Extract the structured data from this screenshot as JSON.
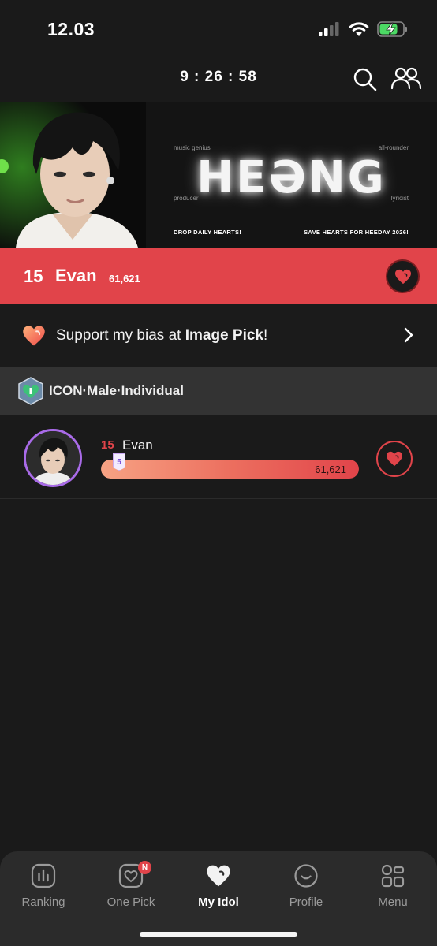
{
  "status": {
    "time": "12.03"
  },
  "header": {
    "timer": "9 : 26 : 58"
  },
  "banner": {
    "title": "HEƏNG",
    "tag_top_left": "music genius",
    "tag_top_right": "all-rounder",
    "tag_bottom_left": "producer",
    "tag_bottom_right": "lyricist",
    "footer_left": "DROP DAILY HEARTS!",
    "footer_right": "SAVE HEARTS FOR HEEDAY 2026!"
  },
  "rank_bar": {
    "rank": "15",
    "name": "Evan",
    "votes": "61,621"
  },
  "support": {
    "text_before": "Support my bias at ",
    "text_bold": "Image Pick",
    "text_after": "!"
  },
  "category": {
    "label": "ICON·Male·Individual"
  },
  "idol": {
    "rank": "15",
    "name": "Evan",
    "votes": "61,621",
    "level": "5",
    "progress_fraction": 1.0
  },
  "nav": {
    "items": [
      {
        "label": "Ranking",
        "icon": "ranking-icon"
      },
      {
        "label": "One Pick",
        "icon": "one-pick-icon",
        "badge": "N"
      },
      {
        "label": "My Idol",
        "icon": "my-idol-icon",
        "active": true
      },
      {
        "label": "Profile",
        "icon": "profile-icon"
      },
      {
        "label": "Menu",
        "icon": "menu-icon"
      }
    ]
  },
  "colors": {
    "accent": "#e1444a",
    "background": "#1a1a1a",
    "nav_bg": "#2b2b2b",
    "avatar_ring": "#a96be8"
  }
}
